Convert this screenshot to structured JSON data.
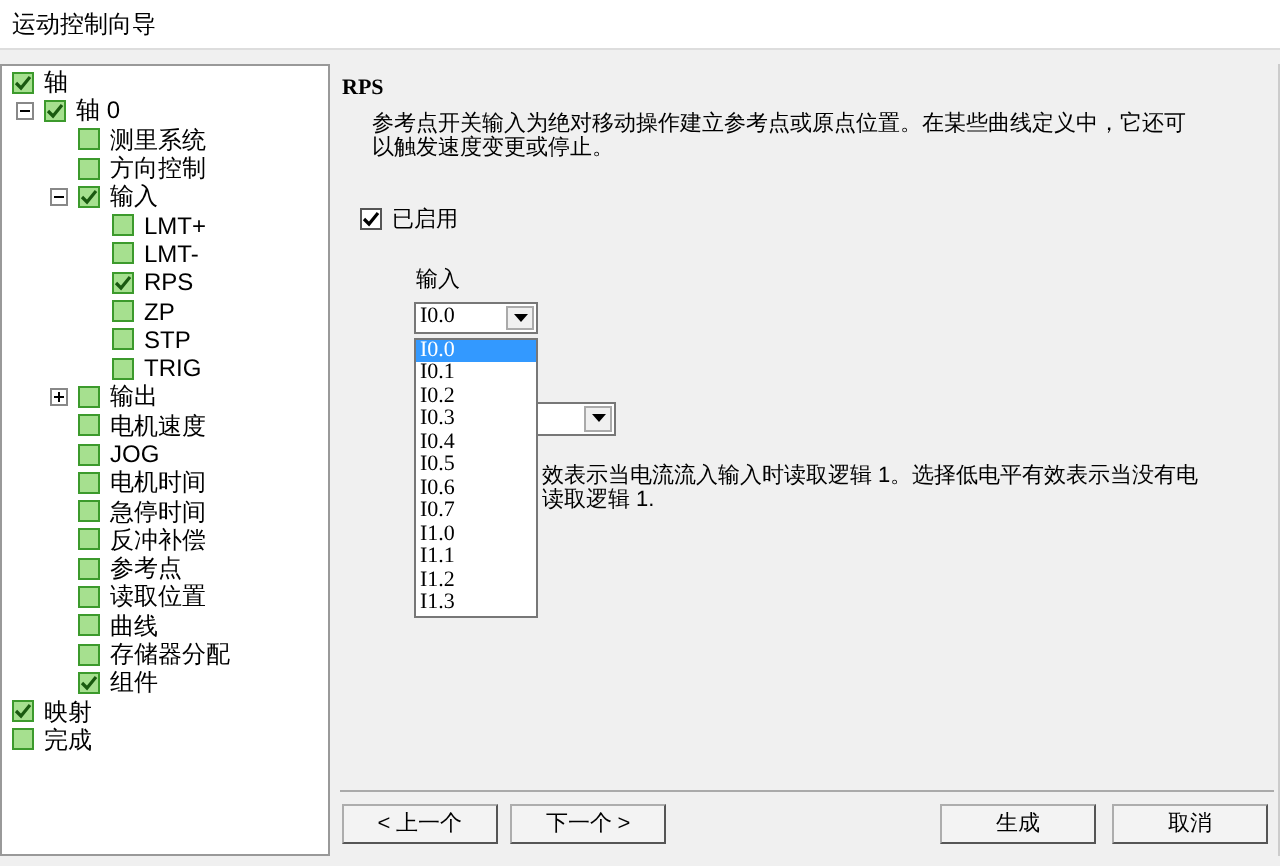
{
  "window": {
    "title": "运动控制向导"
  },
  "tree": [
    {
      "label": "轴",
      "checked": true,
      "children": [
        {
          "label": "轴 0",
          "checked": true,
          "expanded": true,
          "children": [
            {
              "label": "测里系统",
              "checked": false
            },
            {
              "label": "方向控制",
              "checked": false
            },
            {
              "label": "输入",
              "checked": true,
              "expanded": true,
              "children": [
                {
                  "label": "LMT+",
                  "checked": false
                },
                {
                  "label": "LMT-",
                  "checked": false
                },
                {
                  "label": "RPS",
                  "checked": true
                },
                {
                  "label": "ZP",
                  "checked": false
                },
                {
                  "label": "STP",
                  "checked": false
                },
                {
                  "label": "TRIG",
                  "checked": false
                }
              ]
            },
            {
              "label": "输出",
              "checked": false,
              "expanded": false
            },
            {
              "label": "电机速度",
              "checked": false
            },
            {
              "label": "JOG",
              "checked": false
            },
            {
              "label": "电机时间",
              "checked": false
            },
            {
              "label": "急停时间",
              "checked": false
            },
            {
              "label": "反冲补偿",
              "checked": false
            },
            {
              "label": "参考点",
              "checked": false
            },
            {
              "label": "读取位置",
              "checked": false
            },
            {
              "label": "曲线",
              "checked": false
            },
            {
              "label": "存储器分配",
              "checked": false
            },
            {
              "label": "组件",
              "checked": true
            }
          ]
        }
      ]
    },
    {
      "label": "映射",
      "checked": true
    },
    {
      "label": "完成",
      "checked": false
    }
  ],
  "page": {
    "heading": "RPS",
    "description": "参考点开关输入为绝对移动操作建立参考点或原点位置。在某些曲线定义中，它还可以触发速度变更或停止。",
    "enabled": {
      "label": "已启用",
      "checked": true
    },
    "input": {
      "label": "输入",
      "value": "I0.0",
      "expanded": true,
      "options": [
        {
          "label": "I0.0",
          "selected": true
        },
        {
          "label": "I0.1",
          "selected": false
        },
        {
          "label": "I0.2",
          "selected": false
        },
        {
          "label": "I0.3",
          "selected": false
        },
        {
          "label": "I0.4",
          "selected": false
        },
        {
          "label": "I0.5",
          "selected": false
        },
        {
          "label": "I0.6",
          "selected": false
        },
        {
          "label": "I0.7",
          "selected": false
        },
        {
          "label": "I1.0",
          "selected": false
        },
        {
          "label": "I1.1",
          "selected": false
        },
        {
          "label": "I1.2",
          "selected": false
        },
        {
          "label": "I1.3",
          "selected": false
        }
      ]
    },
    "note_lines": [
      "效表示当电流流入输入时读取逻辑 1。选择低电平有效表示当没有电",
      "读取逻辑 1."
    ]
  },
  "buttons": {
    "back": "< 上一个",
    "next": "下一个 >",
    "generate": "生成",
    "cancel": "取消"
  }
}
